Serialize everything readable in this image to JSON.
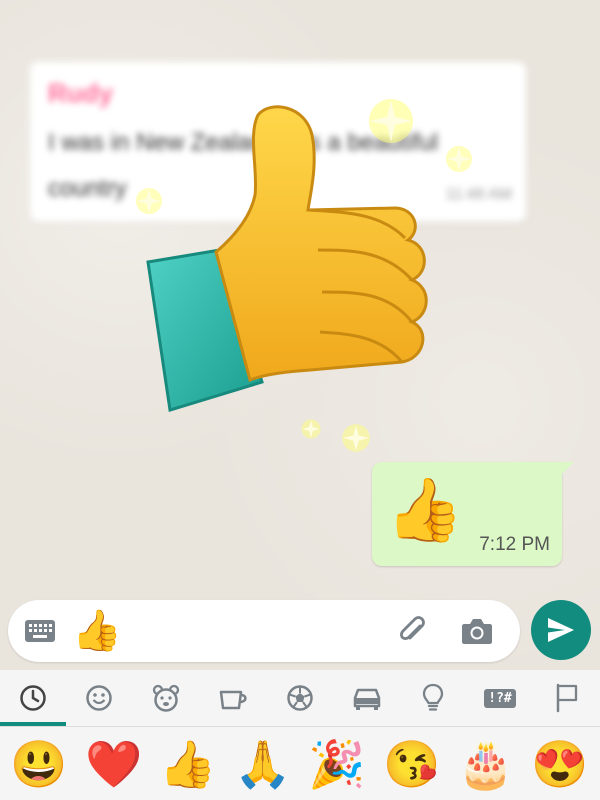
{
  "incoming_message": {
    "sender": "Rudy",
    "text": "I was in New Zealand. It's a beautiful country",
    "time": "11:48 AM"
  },
  "outgoing_message": {
    "emoji": "👍",
    "time": "7:12 PM"
  },
  "input": {
    "value": "👍",
    "keyboard_icon": "keyboard-icon",
    "attach_icon": "paperclip-icon",
    "camera_icon": "camera-icon"
  },
  "send_icon": "send-icon",
  "emoji_tabs": [
    {
      "name": "recent",
      "icon": "clock-icon",
      "active": true
    },
    {
      "name": "smileys",
      "icon": "smiley-icon"
    },
    {
      "name": "animals",
      "icon": "bear-icon"
    },
    {
      "name": "food",
      "icon": "cup-icon"
    },
    {
      "name": "activities",
      "icon": "soccer-ball-icon"
    },
    {
      "name": "travel",
      "icon": "car-icon"
    },
    {
      "name": "objects",
      "icon": "lightbulb-icon"
    },
    {
      "name": "symbols",
      "icon": "symbols-icon",
      "label": "!?#"
    },
    {
      "name": "flags",
      "icon": "flag-icon"
    }
  ],
  "recent_emojis": [
    "😃",
    "❤️",
    "👍",
    "🙏",
    "🎉",
    "😘",
    "🎂",
    "😍"
  ],
  "colors": {
    "accent": "#128c7e",
    "outgoing_bubble": "#dcf8c6",
    "chat_background": "#e9e4dc"
  }
}
